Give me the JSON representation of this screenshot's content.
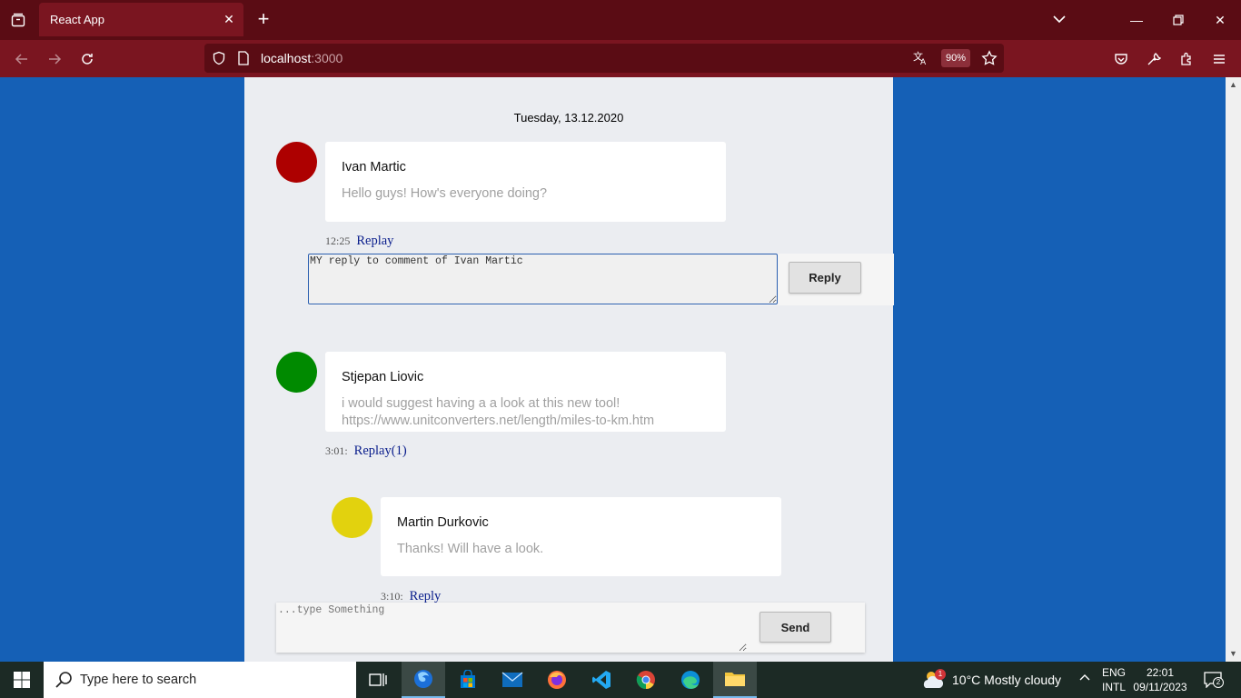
{
  "browser": {
    "tab_title": "React App",
    "url_host": "localhost",
    "url_port": ":3000",
    "zoom": "90%"
  },
  "page": {
    "date": "Tuesday, 13.12.2020",
    "comments": [
      {
        "author": "Ivan Martic",
        "message": "Hello guys! How's everyone doing?",
        "time": "12:25",
        "reply_label": "Replay",
        "avatar_color": "#ad0000"
      },
      {
        "author": "Stjepan Liovic",
        "message": "i would suggest having a a look at this new tool! https://www.unitconverters.net/length/miles-to-km.htm",
        "time": "3:01:",
        "reply_label": "Replay(1)",
        "avatar_color": "#008a00"
      }
    ],
    "nested_reply": {
      "author": "Martin Durkovic",
      "message": "Thanks! Will have a look.",
      "time": "3:10:",
      "reply_label": "Reply",
      "avatar_color": "#e2d20e"
    },
    "reply_form": {
      "value": "MY reply to comment of Ivan Martic",
      "button": "Reply"
    },
    "send_form": {
      "placeholder": "...type Something",
      "button": "Send"
    }
  },
  "taskbar": {
    "search_placeholder": "Type here to search",
    "weather": "10°C  Mostly cloudy",
    "weather_badge": "1",
    "lang_line1": "ENG",
    "lang_line2": "INTL",
    "time": "22:01",
    "date": "09/11/2023",
    "notifications": "2"
  }
}
